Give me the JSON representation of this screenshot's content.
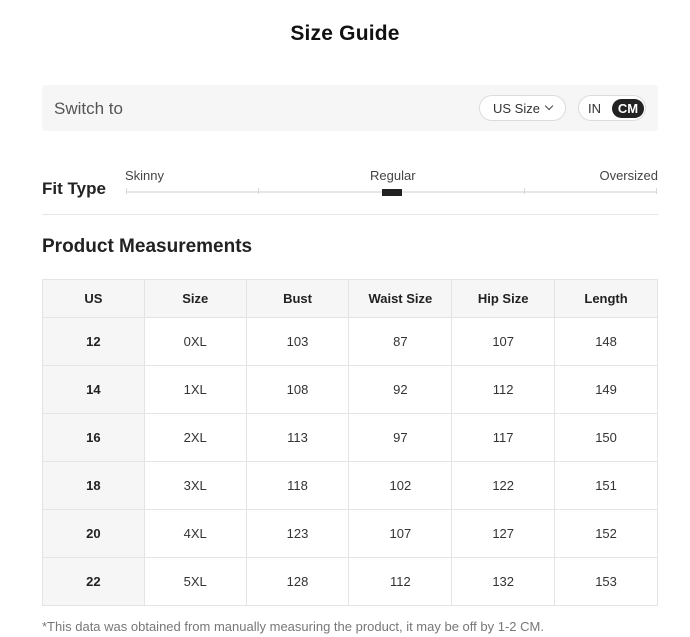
{
  "page": {
    "title": "Size Guide"
  },
  "switch_bar": {
    "label": "Switch to",
    "size_system": "US Size",
    "units": {
      "in_label": "IN",
      "cm_label": "CM",
      "selected": "CM"
    }
  },
  "fit_type": {
    "label": "Fit Type",
    "options": [
      "Skinny",
      "Regular",
      "Oversized"
    ],
    "selected": "Regular"
  },
  "measurements": {
    "title": "Product Measurements",
    "columns": [
      "US",
      "Size",
      "Bust",
      "Waist Size",
      "Hip Size",
      "Length"
    ],
    "rows": [
      [
        "12",
        "0XL",
        "103",
        "87",
        "107",
        "148"
      ],
      [
        "14",
        "1XL",
        "108",
        "92",
        "112",
        "149"
      ],
      [
        "16",
        "2XL",
        "113",
        "97",
        "117",
        "150"
      ],
      [
        "18",
        "3XL",
        "118",
        "102",
        "122",
        "151"
      ],
      [
        "20",
        "4XL",
        "123",
        "107",
        "127",
        "152"
      ],
      [
        "22",
        "5XL",
        "128",
        "112",
        "132",
        "153"
      ]
    ]
  },
  "note": "*This data was obtained from manually measuring the product, it may be off by 1-2 CM.",
  "colors": {
    "accent": "#222222",
    "panel_bg": "#f6f6f6",
    "border": "#e4e4e4"
  }
}
